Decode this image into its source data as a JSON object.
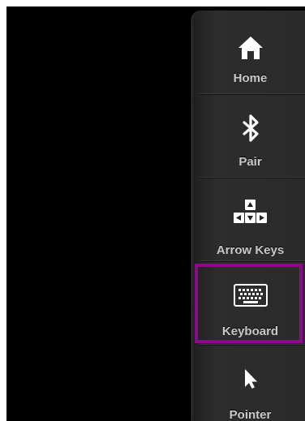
{
  "sidebar": {
    "items": [
      {
        "label": "Home",
        "icon": "home-icon"
      },
      {
        "label": "Pair",
        "icon": "bluetooth-icon"
      },
      {
        "label": "Arrow Keys",
        "icon": "arrow-keys-icon"
      },
      {
        "label": "Keyboard",
        "icon": "keyboard-icon",
        "selected": true
      },
      {
        "label": "Pointer",
        "icon": "pointer-icon"
      }
    ],
    "highlight_color": "#8a0a8a"
  }
}
